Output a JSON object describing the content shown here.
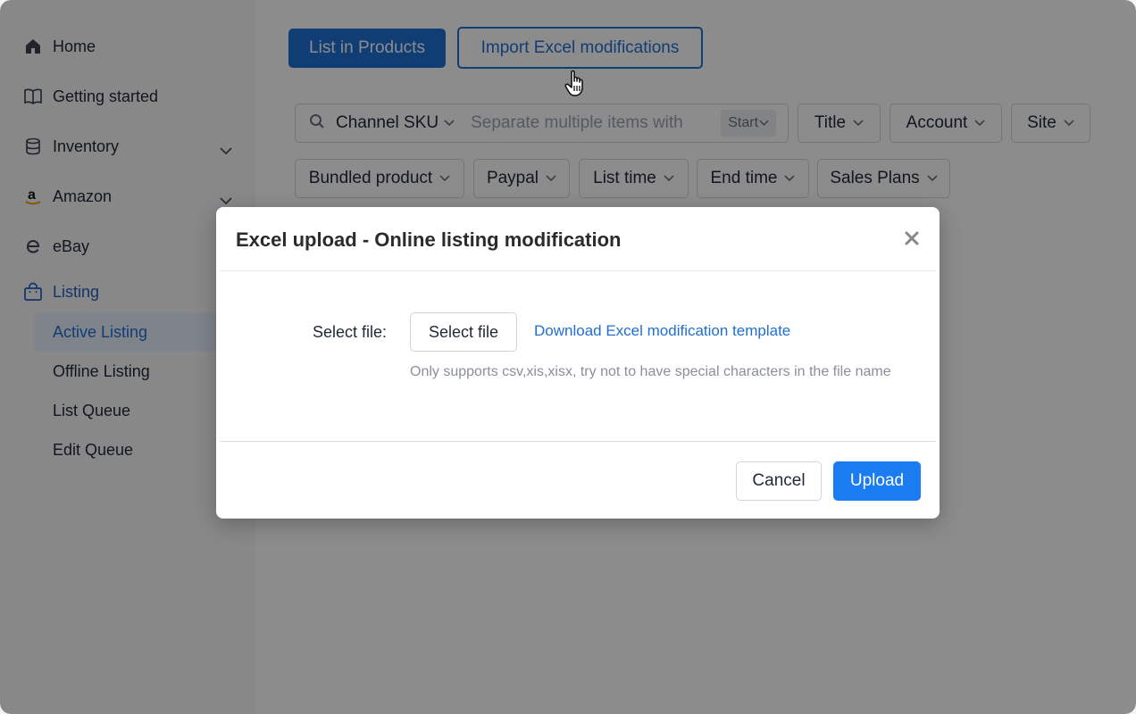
{
  "sidebar": {
    "items": [
      {
        "label": "Home",
        "icon": "home-icon"
      },
      {
        "label": "Getting started",
        "icon": "book-icon"
      },
      {
        "label": "Inventory",
        "icon": "database-icon"
      },
      {
        "label": "Amazon",
        "icon": "amazon-icon"
      },
      {
        "label": "eBay",
        "icon": "ebay-icon"
      },
      {
        "label": "Listing",
        "icon": "shopping-bag-icon"
      }
    ],
    "listing_sub": [
      {
        "label": "Active Listing"
      },
      {
        "label": "Offline Listing"
      },
      {
        "label": "List Queue"
      },
      {
        "label": "Edit Queue"
      }
    ]
  },
  "toolbar": {
    "list_in_products": "List in Products",
    "import_excel": "Import Excel modifications"
  },
  "search": {
    "field": "Channel SKU",
    "placeholder": "Separate multiple items with",
    "mode": "Start"
  },
  "filters": {
    "title": "Title",
    "account": "Account",
    "site": "Site",
    "bundled": "Bundled product",
    "paypal": "Paypal",
    "list_time": "List time",
    "end_time": "End time",
    "sales_plans": "Sales Plans"
  },
  "modal": {
    "title": "Excel upload - Online listing modification",
    "select_label": "Select file:",
    "select_button": "Select file",
    "download_link": "Download Excel modification template",
    "hint": "Only supports csv,xis,xisx, try not to have special characters in the file name",
    "cancel": "Cancel",
    "upload": "Upload"
  },
  "colors": {
    "primary": "#1f6fd6",
    "upload": "#1a7cf0"
  }
}
